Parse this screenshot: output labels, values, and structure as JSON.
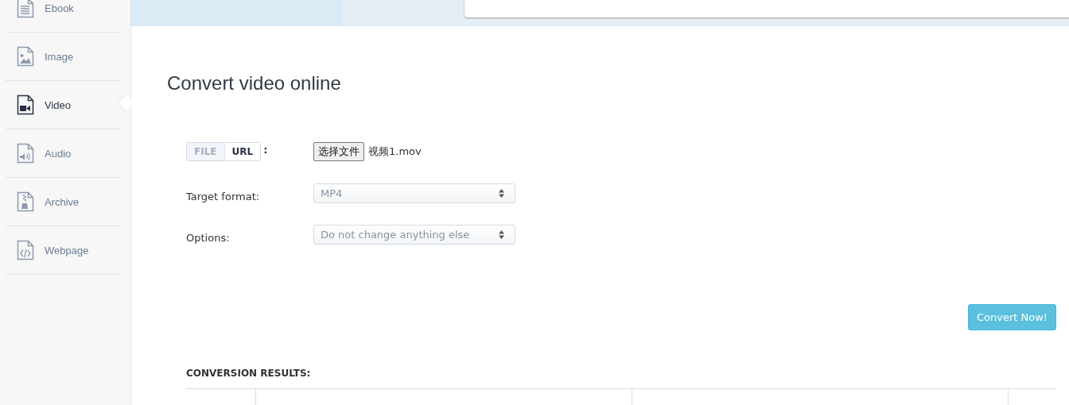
{
  "sidebar": {
    "items": [
      {
        "label": "Ebook",
        "kind": "ebook",
        "selected": false
      },
      {
        "label": "Image",
        "kind": "image",
        "selected": false
      },
      {
        "label": "Video",
        "kind": "video",
        "selected": true
      },
      {
        "label": "Audio",
        "kind": "audio",
        "selected": false
      },
      {
        "label": "Archive",
        "kind": "archive",
        "selected": false
      },
      {
        "label": "Webpage",
        "kind": "webpage",
        "selected": false
      }
    ]
  },
  "heading": "Convert video online",
  "source": {
    "tabs": [
      {
        "label": "FILE",
        "selected": false
      },
      {
        "label": "URL",
        "selected": true
      }
    ],
    "colon": ":",
    "choose_button": "选择文件",
    "file_name": "视频1.mov"
  },
  "fields": [
    {
      "label": "Target format:",
      "value": "MP4"
    },
    {
      "label": "Options:",
      "value": "Do not change anything else"
    }
  ],
  "convert_button": "Convert Now!",
  "results": {
    "title": "CONVERSION RESULTS:"
  }
}
